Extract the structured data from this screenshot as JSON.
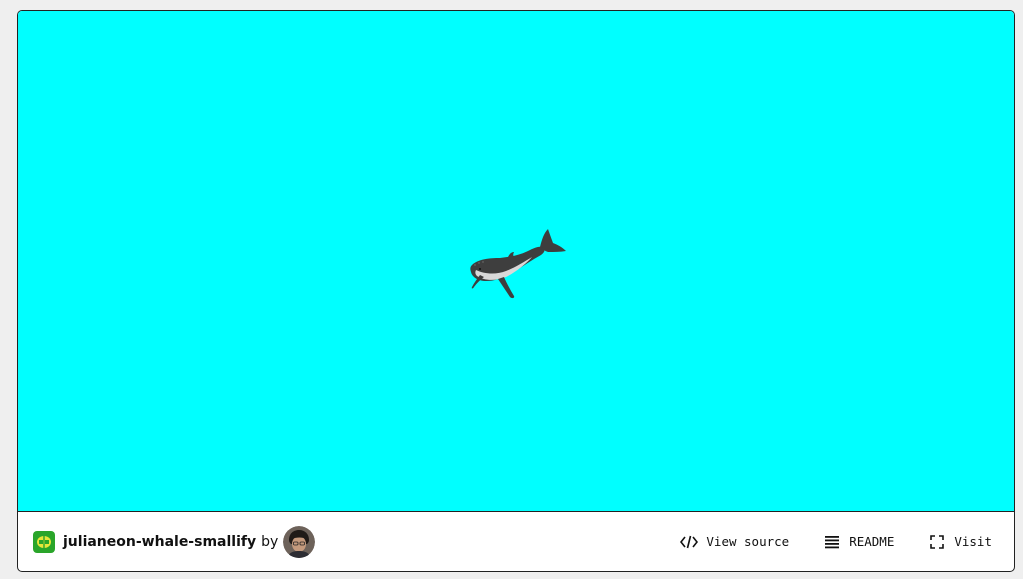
{
  "stage": {
    "background_color": "#00ffff",
    "content": "whale-illustration"
  },
  "footer": {
    "project_name": "julianeon-whale-smallify",
    "by_label": "by",
    "project_icon": "glitch-project-icon",
    "avatar": "user-avatar",
    "actions": {
      "view_source": "View source",
      "readme": "README",
      "visit": "Visit"
    },
    "icons": {
      "view_source": "code-brackets-icon",
      "readme": "list-lines-icon",
      "visit": "fullscreen-corners-icon"
    }
  }
}
